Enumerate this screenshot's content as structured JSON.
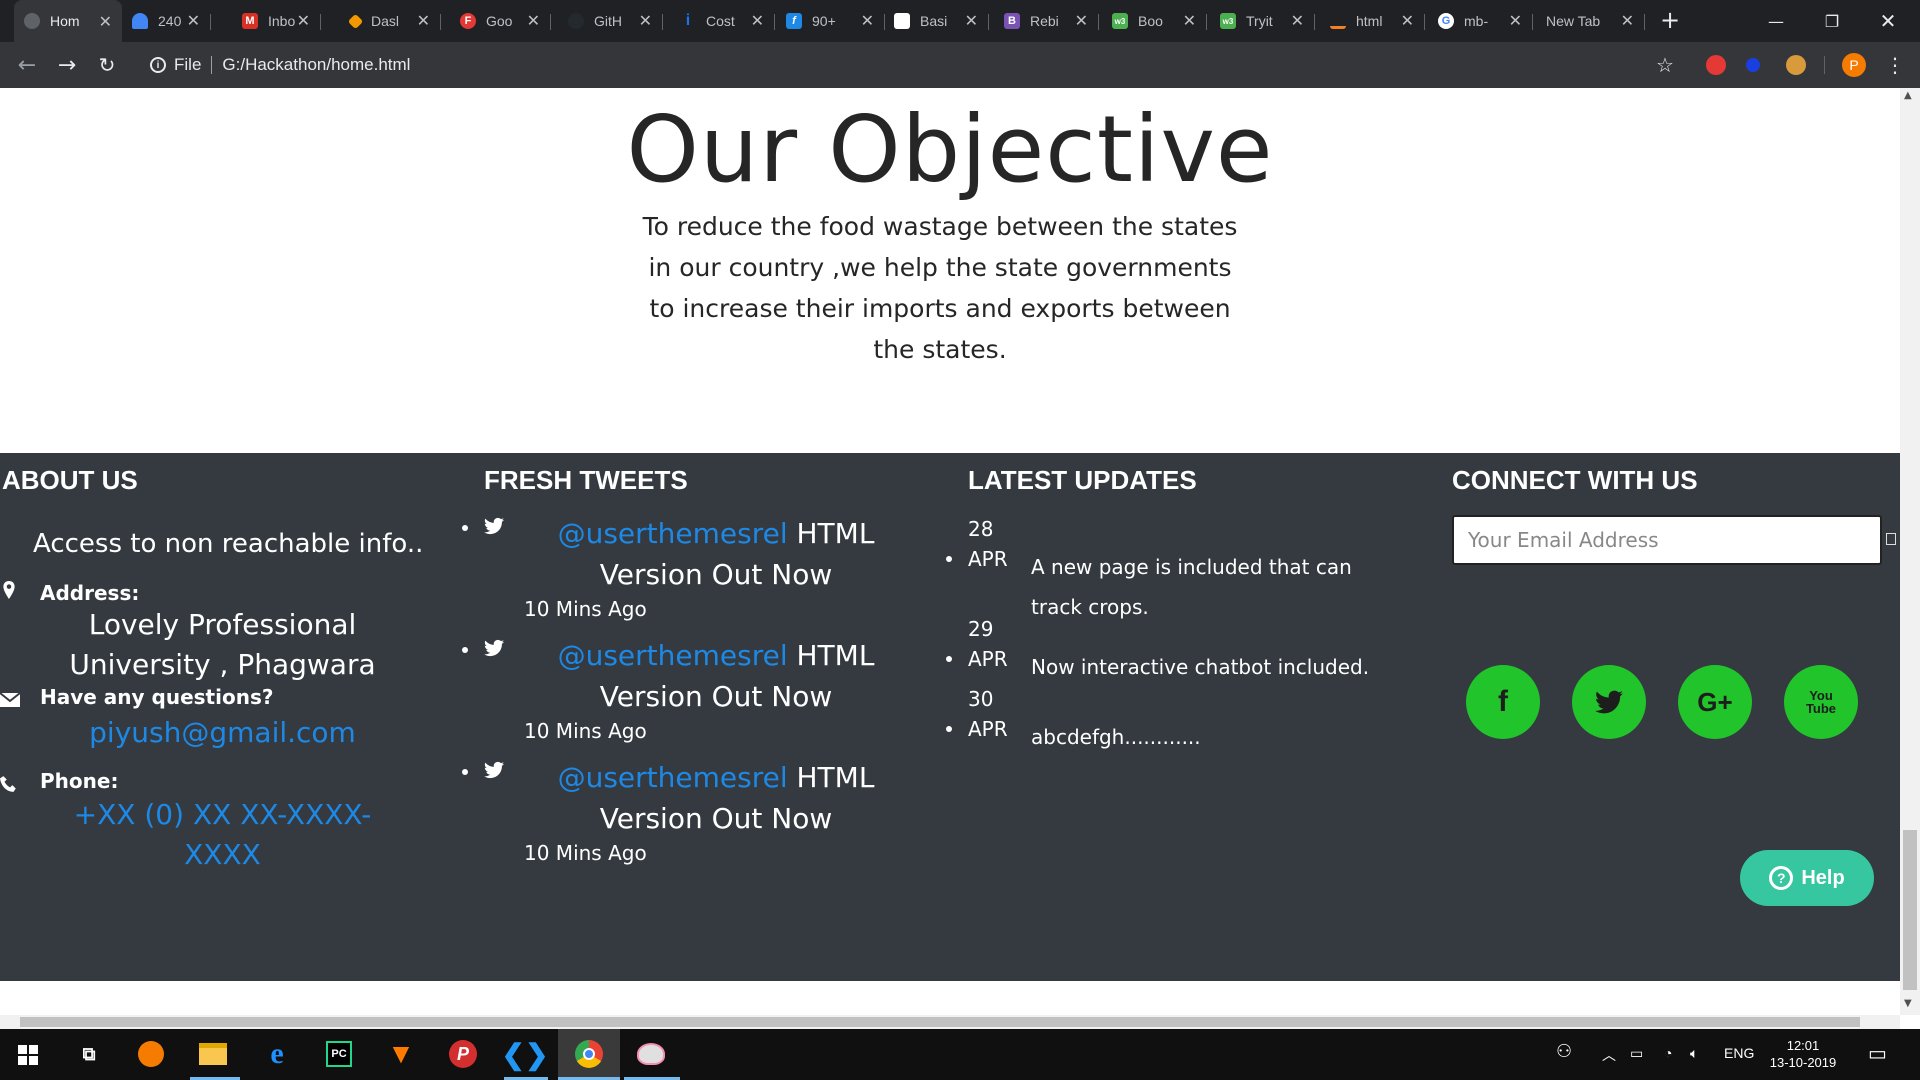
{
  "browser": {
    "tabs": [
      {
        "label": "Hom",
        "color": "#5f6368",
        "glyph": ""
      },
      {
        "label": "240",
        "color": "#4285f4",
        "glyph": ""
      },
      {
        "label": "Inbo",
        "color": "#d93025",
        "glyph": "M"
      },
      {
        "label": "Dasl",
        "color": "#f29900",
        "glyph": ""
      },
      {
        "label": "Goo",
        "color": "#e53935",
        "glyph": "F"
      },
      {
        "label": "GitH",
        "color": "#24292e",
        "glyph": ""
      },
      {
        "label": "Cost",
        "color": "#1a73e8",
        "glyph": "i"
      },
      {
        "label": "90+",
        "color": "#1e88e5",
        "glyph": "f"
      },
      {
        "label": "Basi",
        "color": "#ffffff",
        "glyph": ""
      },
      {
        "label": "Rebi",
        "color": "#7952b3",
        "glyph": "B"
      },
      {
        "label": "Boo",
        "color": "#4caf50",
        "glyph": "w3"
      },
      {
        "label": "Tryit",
        "color": "#4caf50",
        "glyph": "w3"
      },
      {
        "label": "html",
        "color": "#f48024",
        "glyph": ""
      },
      {
        "label": "mb-",
        "color": "#ffffff",
        "glyph": "G"
      },
      {
        "label": "New Tab",
        "color": "",
        "glyph": ""
      }
    ],
    "url_scheme": "File",
    "url": "G:/Hackathon/home.html",
    "profile_initial": "P"
  },
  "objective": {
    "title": "Our Objective",
    "text": "To reduce the food wastage between the states in our country ,we help the state governments to increase their imports and exports between the states."
  },
  "footer": {
    "about": {
      "heading": "ABOUT US",
      "tagline": "Access to non reachable info..",
      "address_label": "Address:",
      "address_value": "Lovely Professional University , Phagwara",
      "questions_label": "Have any questions?",
      "email": "piyush@gmail.com",
      "phone_label": "Phone:",
      "phone": "+XX (0) XX XX-XXXX-XXXX"
    },
    "tweets": {
      "heading": "FRESH TWEETS",
      "items": [
        {
          "handle": "@userthemesrel",
          "text": "HTML Version Out Now",
          "time": "10 Mins Ago"
        },
        {
          "handle": "@userthemesrel",
          "text": "HTML Version Out Now",
          "time": "10 Mins Ago"
        },
        {
          "handle": "@userthemesrel",
          "text": "HTML Version Out Now",
          "time": "10 Mins Ago"
        }
      ]
    },
    "updates": {
      "heading": "LATEST UPDATES",
      "items": [
        {
          "day": "28",
          "month": "APR",
          "text": "A new page is included that can track crops."
        },
        {
          "day": "29",
          "month": "APR",
          "text": "Now interactive chatbot included."
        },
        {
          "day": "30",
          "month": "APR",
          "text": "abcdefgh............"
        }
      ]
    },
    "connect": {
      "heading": "CONNECT WITH US",
      "email_placeholder": "Your Email Address",
      "socials": [
        {
          "name": "facebook",
          "glyph": "f"
        },
        {
          "name": "twitter",
          "glyph": ""
        },
        {
          "name": "google-plus",
          "glyph": "G+"
        },
        {
          "name": "youtube",
          "glyph": "You Tube"
        }
      ]
    }
  },
  "help_button": {
    "label": "Help"
  },
  "taskbar": {
    "language": "ENG",
    "time": "12:01",
    "date": "13-10-2019"
  },
  "colors": {
    "footer_bg": "#343a40",
    "accent_blue": "#1e88e5",
    "social_green": "#21c42a",
    "help_teal": "#36c7a0"
  }
}
